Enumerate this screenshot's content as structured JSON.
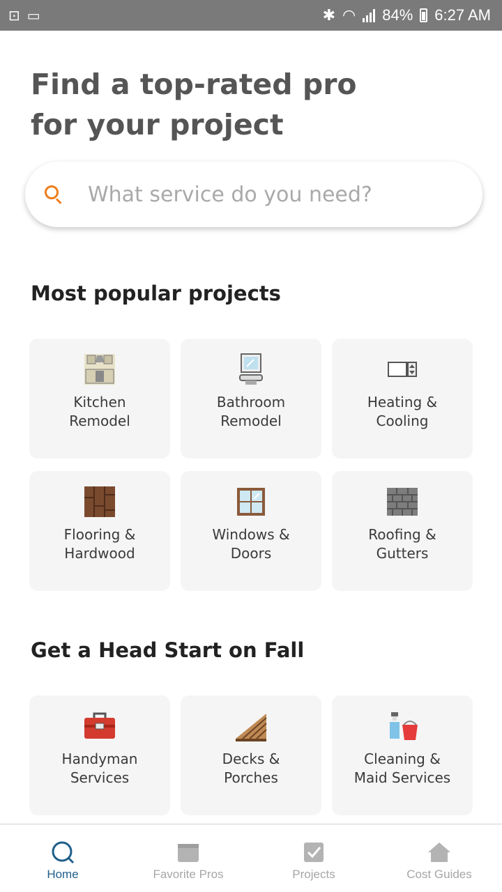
{
  "status_bar": {
    "battery": "84%",
    "time": "6:27 AM"
  },
  "hero": {
    "line1": "Find a top-rated pro",
    "line2": "for your project"
  },
  "search": {
    "placeholder": "What service do you need?",
    "icon": "search-icon"
  },
  "popular": {
    "title": "Most popular projects",
    "items": [
      {
        "label": "Kitchen Remodel",
        "icon": "kitchen-icon"
      },
      {
        "label": "Bathroom Remodel",
        "icon": "bathroom-icon"
      },
      {
        "label": "Heating & Cooling",
        "icon": "hvac-icon"
      },
      {
        "label": "Flooring & Hardwood",
        "icon": "flooring-icon"
      },
      {
        "label": "Windows & Doors",
        "icon": "window-icon"
      },
      {
        "label": "Roofing & Gutters",
        "icon": "roofing-icon"
      }
    ]
  },
  "fall": {
    "title": "Get a Head Start on Fall",
    "items": [
      {
        "label": "Handyman Services",
        "icon": "toolbox-icon"
      },
      {
        "label": "Decks & Porches",
        "icon": "deck-icon"
      },
      {
        "label": "Cleaning & Maid Services",
        "icon": "cleaning-icon"
      }
    ]
  },
  "bottom_nav": {
    "items": [
      {
        "label": "Home",
        "icon": "home-search-icon",
        "active": true
      },
      {
        "label": "Favorite Pros",
        "icon": "favorite-icon",
        "active": false
      },
      {
        "label": "Projects",
        "icon": "projects-icon",
        "active": false
      },
      {
        "label": "Cost Guides",
        "icon": "cost-guide-icon",
        "active": false
      }
    ]
  },
  "colors": {
    "accent": "#ef7d1a",
    "active_nav": "#1f5f8b",
    "inactive_nav": "#a6a6a6",
    "card_bg": "#f5f5f5"
  }
}
